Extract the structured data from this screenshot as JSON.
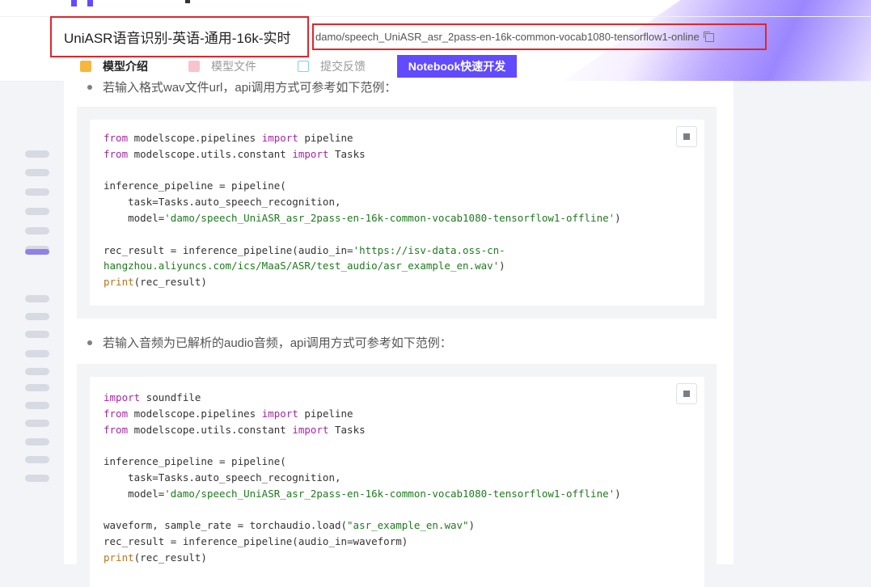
{
  "header": {
    "title": "UniASR语音识别-英语-通用-16k-实时",
    "model_id": "damo/speech_UniASR_asr_2pass-en-16k-common-vocab1080-tensorflow1-online"
  },
  "tabs": [
    {
      "label": "模型介绍",
      "icon": "cube-icon"
    },
    {
      "label": "模型文件",
      "icon": "file-icon"
    },
    {
      "label": "提交反馈",
      "icon": "edit-icon"
    }
  ],
  "notebook_button": "Notebook快速开发",
  "content": {
    "bullet1": "若输入格式wav文件url，api调用方式可参考如下范例：",
    "bullet2": "若输入音频为已解析的audio音频，api调用方式可参考如下范例：",
    "code1": [
      [
        [
          "kw",
          "from"
        ],
        [
          "t",
          " modelscope.pipelines "
        ],
        [
          "kw",
          "import"
        ],
        [
          "t",
          " pipeline"
        ]
      ],
      [
        [
          "kw",
          "from"
        ],
        [
          "t",
          " modelscope.utils.constant "
        ],
        [
          "kw",
          "import"
        ],
        [
          "t",
          " Tasks"
        ]
      ],
      [],
      [
        [
          "t",
          "inference_pipeline = pipeline("
        ]
      ],
      [
        [
          "t",
          "    task=Tasks.auto_speech_recognition,"
        ]
      ],
      [
        [
          "t",
          "    model="
        ],
        [
          "str",
          "'damo/speech_UniASR_asr_2pass-en-16k-common-vocab1080-tensorflow1-offline'"
        ],
        [
          "t",
          ")"
        ]
      ],
      [],
      [
        [
          "t",
          "rec_result = inference_pipeline(audio_in="
        ],
        [
          "str",
          "'https://isv-data.oss-cn-"
        ]
      ],
      [
        [
          "str",
          "hangzhou.aliyuncs.com/ics/MaaS/ASR/test_audio/asr_example_en.wav'"
        ],
        [
          "t",
          ")"
        ]
      ],
      [
        [
          "fn",
          "print"
        ],
        [
          "t",
          "(rec_result)"
        ]
      ]
    ],
    "code2": [
      [
        [
          "kw",
          "import"
        ],
        [
          "t",
          " soundfile"
        ]
      ],
      [
        [
          "kw",
          "from"
        ],
        [
          "t",
          " modelscope.pipelines "
        ],
        [
          "kw",
          "import"
        ],
        [
          "t",
          " pipeline"
        ]
      ],
      [
        [
          "kw",
          "from"
        ],
        [
          "t",
          " modelscope.utils.constant "
        ],
        [
          "kw",
          "import"
        ],
        [
          "t",
          " Tasks"
        ]
      ],
      [],
      [
        [
          "t",
          "inference_pipeline = pipeline("
        ]
      ],
      [
        [
          "t",
          "    task=Tasks.auto_speech_recognition,"
        ]
      ],
      [
        [
          "t",
          "    model="
        ],
        [
          "str",
          "'damo/speech_UniASR_asr_2pass-en-16k-common-vocab1080-tensorflow1-offline'"
        ],
        [
          "t",
          ")"
        ]
      ],
      [],
      [
        [
          "t",
          "waveform, sample_rate = torchaudio.load("
        ],
        [
          "str",
          "\"asr_example_en.wav\""
        ],
        [
          "t",
          ")"
        ]
      ],
      [
        [
          "t",
          "rec_result = inference_pipeline(audio_in=waveform)"
        ]
      ],
      [
        [
          "fn",
          "print"
        ],
        [
          "t",
          "(rec_result)"
        ]
      ]
    ]
  },
  "toc": {
    "item_count": 20,
    "active_index": 6
  },
  "colors": {
    "accent": "#624aff",
    "highlight_border": "#e0262b",
    "keyword": "#a626a4",
    "string": "#1f7a1f",
    "builtin": "#b8741a"
  }
}
